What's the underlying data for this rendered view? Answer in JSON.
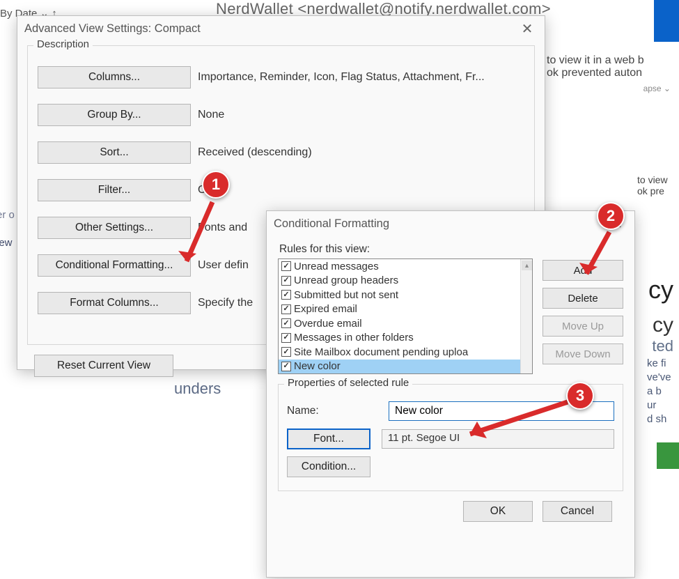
{
  "bg": {
    "email_from": "NerdWallet <nerdwallet@notify.nerdwallet.com>",
    "by_date": "By Date ⌄   ↑",
    "preview1": "to view it in a web b",
    "preview2": "ok prevented auton",
    "apse": "apse ⌄",
    "left1": "er o",
    "left2": "iew",
    "unders": "unders",
    "r_frag1": "to view",
    "r_frag2": "ok pre",
    "r_cy": "cy",
    "r_cy2": "cy",
    "r_ted": "ted",
    "r_words": "ke fi\nve've\na b\nur\nd sh"
  },
  "dlg1": {
    "title": "Advanced View Settings: Compact",
    "group_label": "Description",
    "rows": [
      {
        "btn": "Columns...",
        "val": "Importance, Reminder, Icon, Flag Status, Attachment, Fr..."
      },
      {
        "btn": "Group By...",
        "val": "None"
      },
      {
        "btn": "Sort...",
        "val": "Received (descending)"
      },
      {
        "btn": "Filter...",
        "val": "Off"
      },
      {
        "btn": "Other Settings...",
        "val": "Fonts and"
      },
      {
        "btn": "Conditional Formatting...",
        "val": "User defin"
      },
      {
        "btn": "Format Columns...",
        "val": "Specify the"
      }
    ],
    "reset": "Reset Current View"
  },
  "dlg2": {
    "title": "Conditional Formatting",
    "rules_label": "Rules for this view:",
    "rules": [
      "Unread messages",
      "Unread group headers",
      "Submitted but not sent",
      "Expired email",
      "Overdue email",
      "Messages in other folders",
      "Site Mailbox document pending uploa",
      "New color"
    ],
    "selected_index": 7,
    "btns": {
      "add": "Add",
      "delete": "Delete",
      "move_up": "Move Up",
      "move_down": "Move Down"
    },
    "prop_label": "Properties of selected rule",
    "name_label": "Name:",
    "name_value": "New color",
    "font_btn": "Font...",
    "font_display": "11 pt. Segoe UI",
    "condition_btn": "Condition...",
    "ok": "OK",
    "cancel": "Cancel"
  },
  "markers": {
    "m1": "1",
    "m2": "2",
    "m3": "3"
  }
}
